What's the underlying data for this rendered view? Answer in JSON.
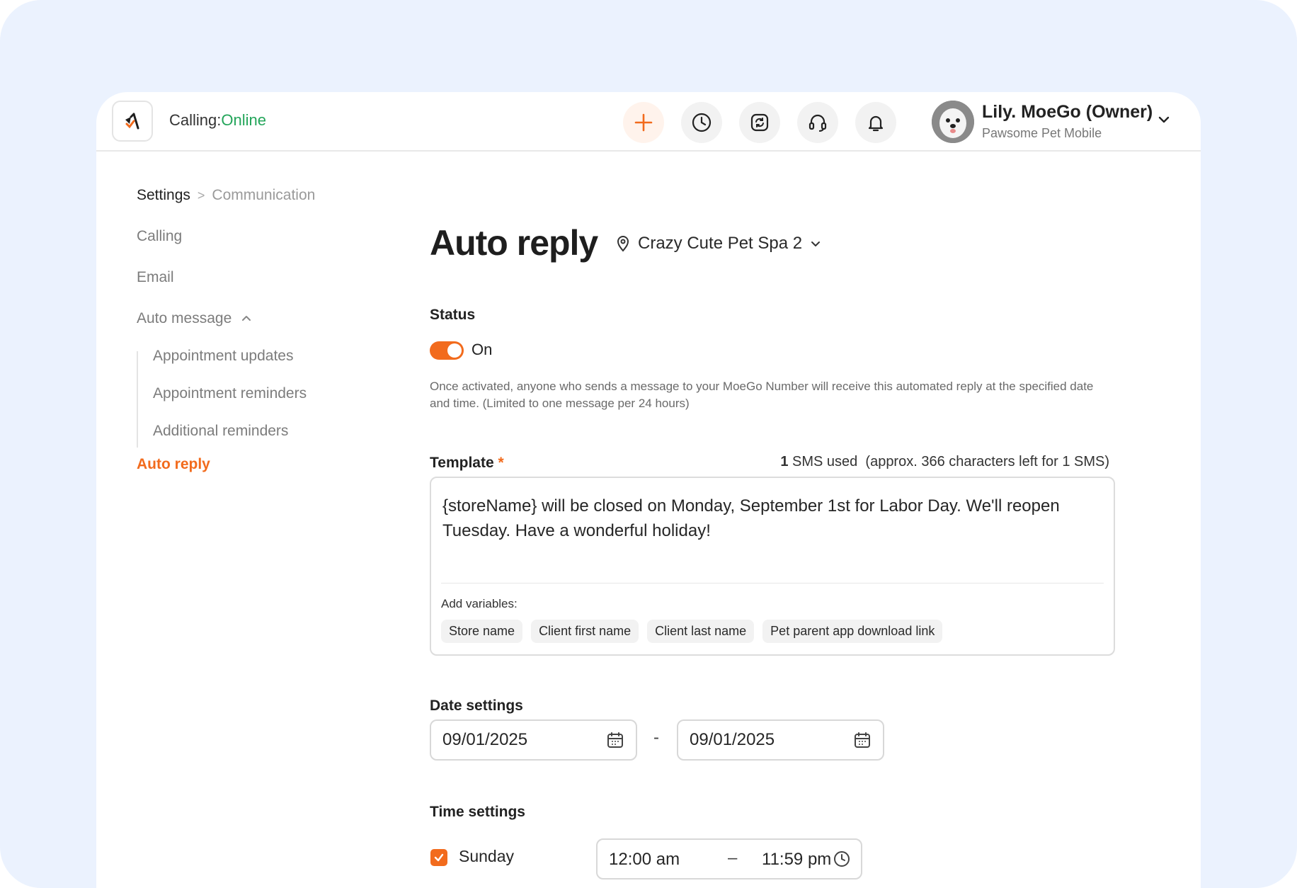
{
  "header": {
    "calling_label": "Calling:",
    "calling_status": "Online",
    "user_name": "Lily. MoeGo (Owner)",
    "user_business": "Pawsome Pet Mobile",
    "icons": [
      "plus-icon",
      "clock-icon",
      "sync-icon",
      "headset-icon",
      "bell-icon"
    ]
  },
  "breadcrumb": {
    "root": "Settings",
    "separator": ">",
    "current": "Communication"
  },
  "nav": {
    "calling": "Calling",
    "email": "Email",
    "auto_message": "Auto message",
    "sub_items": [
      "Appointment updates",
      "Appointment reminders",
      "Additional reminders"
    ],
    "auto_reply": "Auto reply"
  },
  "main": {
    "title": "Auto reply",
    "location": "Crazy Cute Pet Spa 2",
    "status_label": "Status",
    "toggle_state": "On",
    "help_text": "Once activated, anyone who sends a message to your MoeGo Number will receive this automated reply at the specified date and time. (Limited to one message per 24 hours)",
    "template_label": "Template",
    "template_required_mark": "*",
    "sms_count": "1",
    "sms_used_text": "SMS used",
    "sms_left_text": "(approx. 366 characters left for 1 SMS)",
    "template_text": "{storeName} will be closed on Monday, September 1st for Labor Day. We'll reopen Tuesday. Have a wonderful holiday!",
    "add_variables_label": "Add variables:",
    "variables": [
      "Store name",
      "Client first name",
      "Client last name",
      "Pet parent app download link"
    ],
    "date_settings_label": "Date settings",
    "date_start": "09/01/2025",
    "date_separator": "-",
    "date_end": "09/01/2025",
    "time_settings_label": "Time settings",
    "day": "Sunday",
    "time_start": "12:00 am",
    "time_separator": "–",
    "time_end": "11:59 pm"
  },
  "colors": {
    "accent": "#f26b1d",
    "online": "#23a55a",
    "background": "#ebf2fe"
  }
}
